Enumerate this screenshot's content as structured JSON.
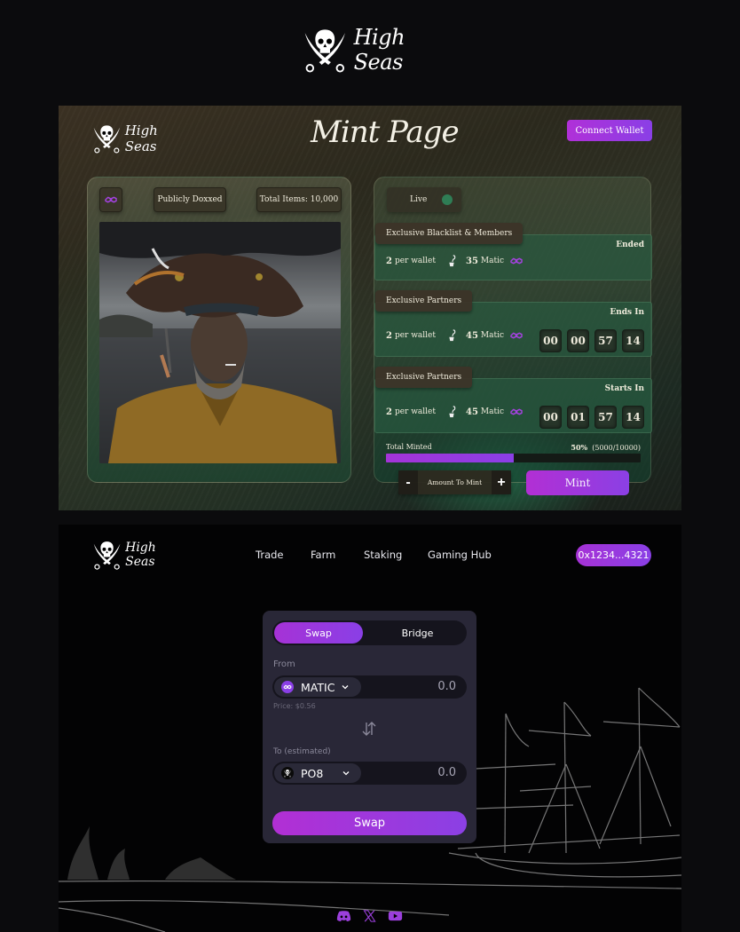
{
  "brand": {
    "name": "High Seas"
  },
  "mint_page": {
    "title": "Mint Page",
    "connect_wallet_label": "Connect Wallet",
    "card": {
      "chain_icon": "polygon-icon",
      "doxxed_label": "Publicly Doxxed",
      "total_items_label": "Total Items: 10,000"
    },
    "panel": {
      "status_label": "Live",
      "status_color": "#2f7d55",
      "phases": [
        {
          "name": "Exclusive Blacklist & Members",
          "status": "Ended",
          "per_wallet_count": "2",
          "per_wallet_label": "per wallet",
          "price": "35",
          "currency": "Matic",
          "timer": null
        },
        {
          "name": "Exclusive Partners",
          "status": "Ends In",
          "per_wallet_count": "2",
          "per_wallet_label": "per wallet",
          "price": "45",
          "currency": "Matic",
          "timer": [
            "00",
            "00",
            "57",
            "14"
          ]
        },
        {
          "name": "Exclusive Partners",
          "status": "Starts In",
          "per_wallet_count": "2",
          "per_wallet_label": "per wallet",
          "price": "45",
          "currency": "Matic",
          "timer": [
            "00",
            "01",
            "57",
            "14"
          ]
        }
      ],
      "total_minted_label": "Total Minted",
      "total_minted_percent": "50%",
      "total_minted_count": "(5000/10000)",
      "progress_fraction": 0.5,
      "amount_label": "Amount To Mint",
      "minus_label": "-",
      "plus_label": "+",
      "mint_label": "Mint"
    }
  },
  "swap_page": {
    "nav": [
      "Trade",
      "Farm",
      "Staking",
      "Gaming Hub"
    ],
    "wallet_address": "0x1234...4321",
    "tabs": {
      "active": "Swap",
      "other": "Bridge"
    },
    "from_label": "From",
    "from_token": "MATIC",
    "from_amount": "0.0",
    "price_label": "Price: $0.56",
    "to_label": "To (estimated)",
    "to_token": "PO8",
    "to_amount": "0.0",
    "swap_button_label": "Swap",
    "socials": [
      "discord-icon",
      "x-twitter-icon",
      "youtube-icon"
    ]
  },
  "colors": {
    "accent_purple": "#a632d6",
    "accent_violet": "#8a3fe6",
    "card_bg": "#292737"
  }
}
